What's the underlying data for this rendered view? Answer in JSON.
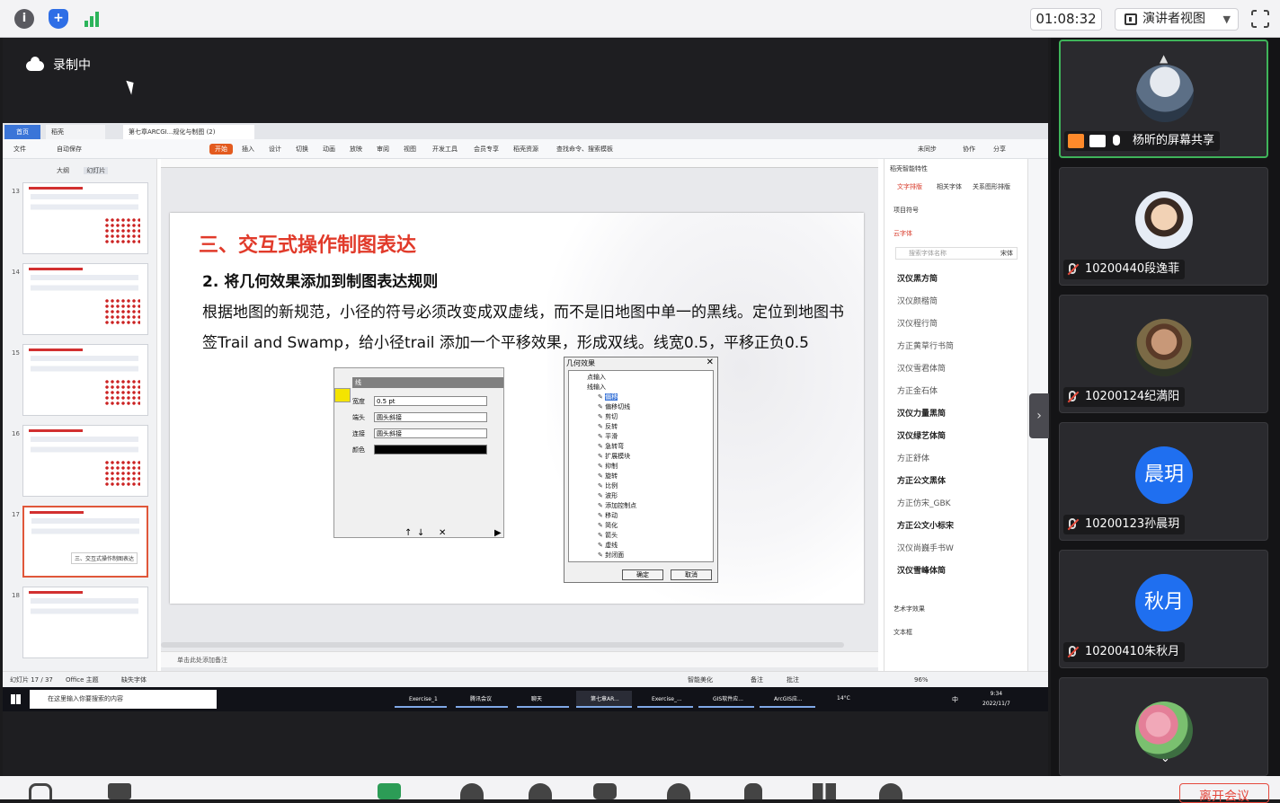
{
  "topbar": {
    "timer": "01:08:32",
    "presenter_view": "演讲者视图",
    "info_icon": "i"
  },
  "recording": {
    "label": "录制中"
  },
  "ppt": {
    "tabs": [
      "首页",
      "稻壳",
      "第七章ARCGI...规化与制图 (2)"
    ],
    "menu": [
      "文件",
      "自动保存",
      "开始",
      "插入",
      "设计",
      "切换",
      "动画",
      "放映",
      "审阅",
      "视图",
      "开发工具",
      "会员专享",
      "稻壳资源",
      "查找命令、搜索模板"
    ],
    "menu_right": [
      "未同步",
      "协作",
      "分享"
    ],
    "thumb_tabs": [
      "大纲",
      "幻灯片"
    ],
    "thumb_numbers": [
      "13",
      "14",
      "15",
      "16",
      "17",
      "18"
    ],
    "thumb_tooltip": "三、交互式操作制图表达",
    "slide": {
      "heading": "三、交互式操作制图表达",
      "subheading": "2. 将几何效果添加到制图表达规则",
      "body": "根据地图的新规范，小径的符号必须改变成双虚线，而不是旧地图中单一的黑线。定位到地图书签Trail and Swamp，给小径trail 添加一个平移效果，形成双线。线宽0.5，平移正负0.5"
    },
    "line_dialog": {
      "header": "线",
      "width_label": "宽度",
      "width_value": "0.5 pt",
      "cap_label": "端头",
      "cap_value": "圆头斜接",
      "join_label": "连接",
      "join_value": "圆头斜接",
      "color_label": "颜色"
    },
    "geo_dialog": {
      "title": "几何效果",
      "group1": "点输入",
      "group2": "线输入",
      "items": [
        "偏移",
        "偏移切线",
        "剪切",
        "反转",
        "平滑",
        "急转弯",
        "扩展模块",
        "抑制",
        "旋转",
        "比例",
        "波形",
        "添加控制点",
        "移动",
        "简化",
        "箭头",
        "虚线",
        "封闭面"
      ],
      "ok": "确定",
      "cancel": "取消"
    },
    "note_placeholder": "单击此处添加备注",
    "right_panel": {
      "tabs": [
        "文字排版",
        "相关字体",
        "关系图形排版"
      ],
      "title": "稻壳智能特性",
      "section1": "项目符号",
      "section2": "云字体",
      "search_placeholder": "搜索字体名称",
      "search_btn": "宋体",
      "fonts": [
        "汉仪黑方简",
        "汉仪颜楷简",
        "汉仪程行简",
        "方正黄草行书简",
        "汉仪雪君体简",
        "方正金石体",
        "汉仪力量黑简",
        "汉仪绿艺体简",
        "方正舒体",
        "方正公文黑体",
        "方正仿宋_GBK",
        "方正公文小标宋",
        "汉仪尚巍手书W",
        "汉仪雪峰体简"
      ],
      "section3": "艺术字效果",
      "section4": "文本框"
    },
    "status": {
      "slide_count": "幻灯片 17 / 37",
      "theme": "Office 主题",
      "missing_font": "缺失字体",
      "smart_beautify": "智能美化",
      "notes": "备注",
      "comments": "批注",
      "zoom": "96%"
    },
    "taskbar": {
      "search_placeholder": "在这里输入你要搜索的内容",
      "tasks": [
        "Exercise_1",
        "腾讯会议",
        "聊天",
        "第七章AR...",
        "Exercise_...",
        "GIS软件应...",
        "ArcGIS应..."
      ],
      "weather": "14°C",
      "ime": "中",
      "time": "9:34",
      "date": "2022/11/7"
    }
  },
  "participants": [
    {
      "name": "杨昕的屏幕共享",
      "avatar": "photo"
    },
    {
      "name": "10200440段逸菲",
      "avatar": "photo"
    },
    {
      "name": "10200124纪満阳",
      "avatar": "photo"
    },
    {
      "name": "10200123孙晨玥",
      "avatar_text": "晨玥"
    },
    {
      "name": "10200410朱秋月",
      "avatar_text": "秋月"
    },
    {
      "name": "",
      "avatar": "photo"
    }
  ],
  "bottombar": {
    "end_label": "离开会议"
  }
}
